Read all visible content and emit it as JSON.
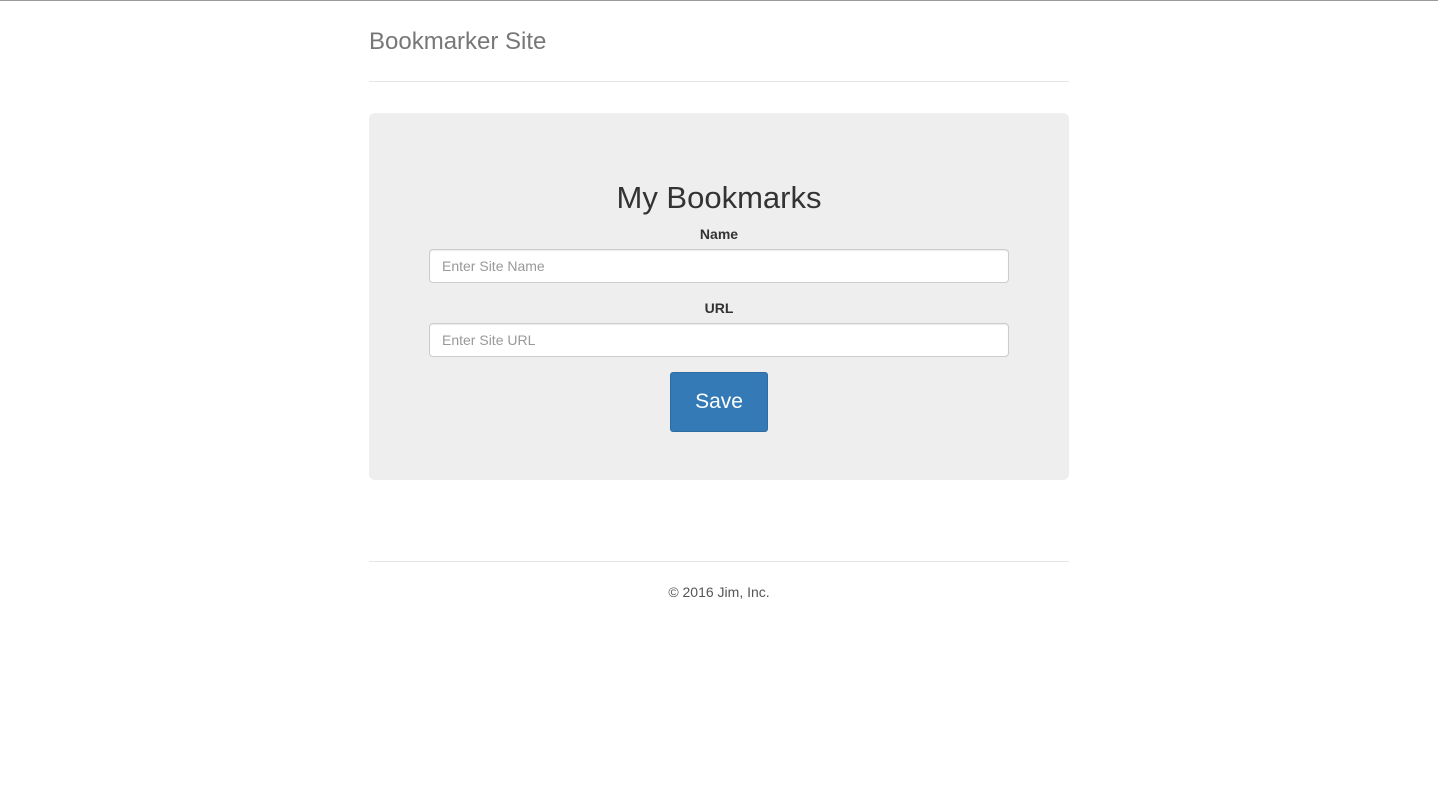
{
  "header": {
    "site_title": "Bookmarker Site"
  },
  "form": {
    "title": "My Bookmarks",
    "name_label": "Name",
    "name_placeholder": "Enter Site Name",
    "name_value": "",
    "url_label": "URL",
    "url_placeholder": "Enter Site URL",
    "url_value": "",
    "save_label": "Save"
  },
  "footer": {
    "copyright": "© 2016 Jim, Inc."
  },
  "colors": {
    "primary_button": "#337ab7",
    "panel_background": "#eeeeee"
  }
}
